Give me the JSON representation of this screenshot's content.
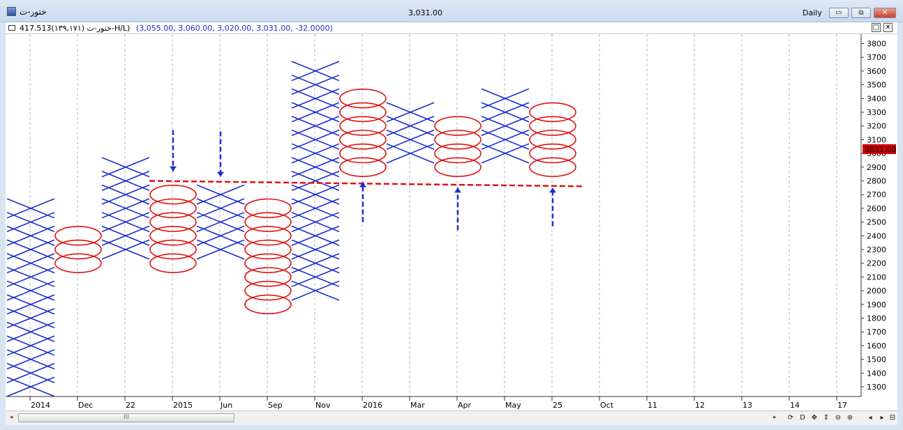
{
  "window": {
    "title": "ختور-ت",
    "last_price": "3,031.00",
    "period": "Daily"
  },
  "info_bar": {
    "name": "ختور-ت (۱۳۹,۱۷۱)",
    "box_reversal": "417.513-H/L)",
    "ohlc": "(3,055.00, 3,060.00, 3,020.00, 3,031.00, -32.0000)"
  },
  "window_buttons": {
    "minimize": "▭",
    "restore": "⧉",
    "close": "✕"
  },
  "chart_buttons": {
    "maximize": "□",
    "close": "✕"
  },
  "colors": {
    "x_color": "#1a2ecc",
    "o_color": "#e01010",
    "trendline": "#e01010",
    "arrow": "#1a2ecc",
    "price_badge": "#cc0000"
  },
  "scroll": {
    "thumb_label": "III",
    "left_arrow": "◂",
    "right_arrow": "▸"
  },
  "nav_buttons": [
    "⟳",
    "D",
    "✥",
    "⇕",
    "⊖",
    "⊕",
    "◂",
    "▸",
    "⊟"
  ],
  "chart_data": {
    "type": "point_and_figure",
    "box_size": 100,
    "ylim": [
      1200,
      3900
    ],
    "y_ticks": [
      1300,
      1400,
      1500,
      1600,
      1700,
      1800,
      1900,
      2000,
      2100,
      2200,
      2300,
      2400,
      2500,
      2600,
      2700,
      2800,
      2900,
      3000,
      3100,
      3200,
      3300,
      3400,
      3500,
      3600,
      3700,
      3800
    ],
    "x_labels": [
      "2014",
      "Dec",
      "22",
      "2015",
      "Jun",
      "Sep",
      "Nov",
      "2016",
      "Mar",
      "Apr",
      "May",
      "25",
      "Oct",
      "11",
      "12",
      "13",
      "14",
      "17"
    ],
    "columns": [
      {
        "type": "X",
        "low": 1300,
        "high": 2600
      },
      {
        "type": "O",
        "low": 2200,
        "high": 2400
      },
      {
        "type": "X",
        "low": 2300,
        "high": 2900
      },
      {
        "type": "O",
        "low": 2200,
        "high": 2700
      },
      {
        "type": "X",
        "low": 2300,
        "high": 2700
      },
      {
        "type": "O",
        "low": 1900,
        "high": 2600
      },
      {
        "type": "X",
        "low": 2000,
        "high": 3600
      },
      {
        "type": "O",
        "low": 2900,
        "high": 3400
      },
      {
        "type": "X",
        "low": 3000,
        "high": 3300
      },
      {
        "type": "O",
        "low": 2900,
        "high": 3200
      },
      {
        "type": "X",
        "low": 3000,
        "high": 3400
      },
      {
        "type": "O",
        "low": 2900,
        "high": 3300
      }
    ],
    "current_price": "3031.00",
    "support_line": {
      "from": {
        "column": 3,
        "price": 2800
      },
      "to": {
        "column": 12,
        "price": 2760
      }
    }
  }
}
